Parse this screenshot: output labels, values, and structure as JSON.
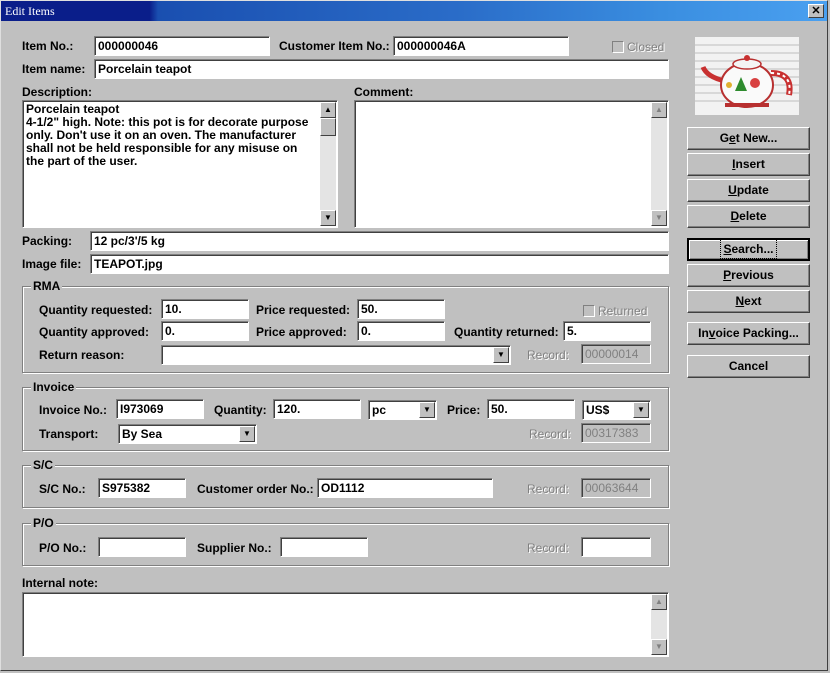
{
  "window": {
    "title": "Edit Items",
    "close_glyph": "✕"
  },
  "item": {
    "item_no_label": "Item No.:",
    "item_no": "000000046",
    "customer_item_no_label": "Customer Item No.:",
    "customer_item_no": "000000046A",
    "closed_label": "Closed",
    "item_name_label": "Item name:",
    "item_name": "Porcelain teapot",
    "description_label": "Description:",
    "description": "Porcelain teapot\n4-1/2\" high. Note: this pot is for decorate purpose only. Don't use it on an oven. The manufacturer shall not be held responsible for any misuse on the part of the user.",
    "comment_label": "Comment:",
    "comment": "",
    "packing_label": "Packing:",
    "packing": "12 pc/3'/5 kg",
    "image_file_label": "Image file:",
    "image_file": "TEAPOT.jpg"
  },
  "rma": {
    "title": "RMA",
    "qty_requested_label": "Quantity requested:",
    "qty_requested": "10.",
    "price_requested_label": "Price requested:",
    "price_requested": "50.",
    "returned_label": "Returned",
    "qty_approved_label": "Quantity approved:",
    "qty_approved": "0.",
    "price_approved_label": "Price approved:",
    "price_approved": "0.",
    "qty_returned_label": "Quantity returned:",
    "qty_returned": "5.",
    "return_reason_label": "Return reason:",
    "return_reason": "",
    "record_label": "Record:",
    "record": "00000014"
  },
  "invoice": {
    "title": "Invoice",
    "invoice_no_label": "Invoice No.:",
    "invoice_no": "I973069",
    "quantity_label": "Quantity:",
    "quantity": "120.",
    "unit": "pc",
    "price_label": "Price:",
    "price": "50.",
    "currency": "US$",
    "transport_label": "Transport:",
    "transport": "By Sea",
    "record_label": "Record:",
    "record": "00317383"
  },
  "sc": {
    "title": "S/C",
    "sc_no_label": "S/C No.:",
    "sc_no": "S975382",
    "customer_order_label": "Customer order No.:",
    "customer_order": "OD1112",
    "record_label": "Record:",
    "record": "00063644"
  },
  "po": {
    "title": "P/O",
    "po_no_label": "P/O No.:",
    "po_no": "",
    "supplier_no_label": "Supplier No.:",
    "supplier_no": "",
    "record_label": "Record:",
    "record": ""
  },
  "internal_note_label": "Internal note:",
  "internal_note": "",
  "buttons": {
    "get_new_pre": "G",
    "get_new_u": "e",
    "get_new_post": "t New...",
    "insert_u": "I",
    "insert_post": "nsert",
    "update_u": "U",
    "update_post": "pdate",
    "delete_u": "D",
    "delete_post": "elete",
    "search_u": "S",
    "search_post": "earch...",
    "previous_u": "P",
    "previous_post": "revious",
    "next_u": "N",
    "next_post": "ext",
    "invoice_packing_pre": "In",
    "invoice_packing_u": "v",
    "invoice_packing_post": "oice Packing...",
    "cancel": "Cancel"
  },
  "icons": {
    "scroll_up": "▲",
    "scroll_down": "▼",
    "dropdown": "▼"
  }
}
